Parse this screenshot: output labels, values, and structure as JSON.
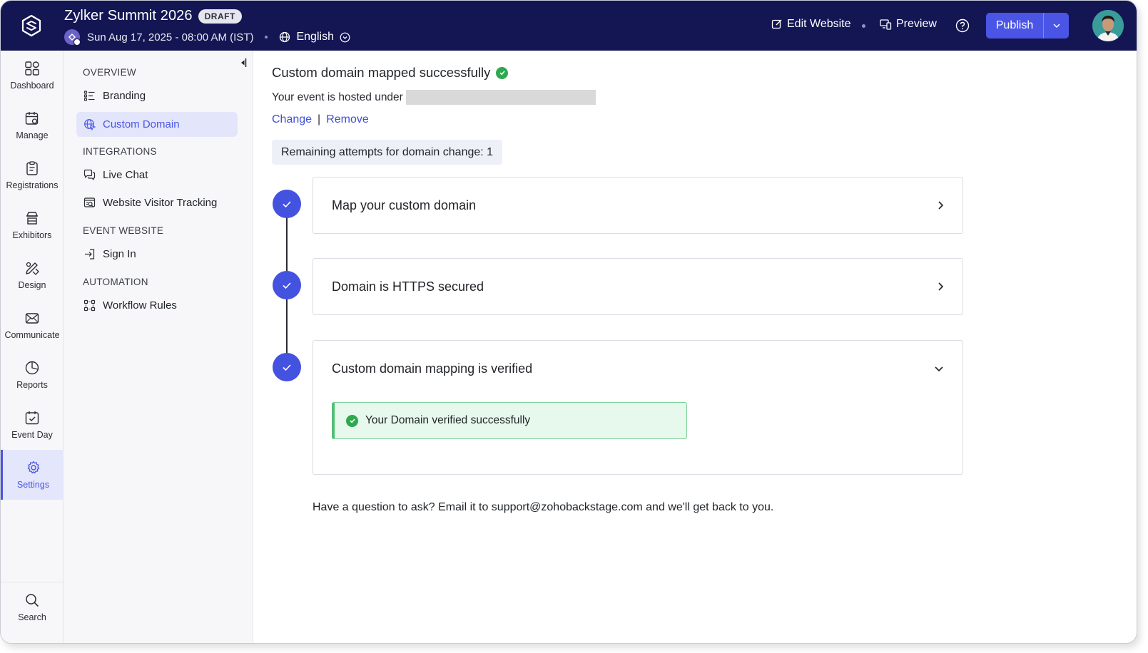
{
  "header": {
    "event_title": "Zylker Summit 2026",
    "draft_badge": "DRAFT",
    "date_time": "Sun Aug 17, 2025 - 08:00 AM (IST)",
    "language": "English",
    "edit_website": "Edit Website",
    "preview": "Preview",
    "publish": "Publish"
  },
  "rail": {
    "items": [
      {
        "label": "Dashboard",
        "icon": "grid-icon"
      },
      {
        "label": "Manage",
        "icon": "calendar-gear-icon"
      },
      {
        "label": "Registrations",
        "icon": "clipboard-icon"
      },
      {
        "label": "Exhibitors",
        "icon": "booth-icon"
      },
      {
        "label": "Design",
        "icon": "pen-ruler-icon"
      },
      {
        "label": "Communicate",
        "icon": "mail-icon"
      },
      {
        "label": "Reports",
        "icon": "pie-chart-icon"
      },
      {
        "label": "Event Day",
        "icon": "calendar-check-icon"
      },
      {
        "label": "Settings",
        "icon": "gear-icon"
      }
    ],
    "search": "Search"
  },
  "subnav": {
    "overview": "OVERVIEW",
    "branding": "Branding",
    "custom_domain": "Custom Domain",
    "integrations": "INTEGRATIONS",
    "live_chat": "Live Chat",
    "visitor_tracking": "Website Visitor Tracking",
    "event_website": "EVENT WEBSITE",
    "sign_in": "Sign In",
    "automation": "AUTOMATION",
    "workflow_rules": "Workflow Rules"
  },
  "main": {
    "success_title": "Custom domain mapped successfully",
    "hosted_under": "Your event is hosted under",
    "change": "Change",
    "pipe": "|",
    "remove": "Remove",
    "attempts": "Remaining attempts for domain change: 1",
    "steps": [
      {
        "title": "Map your custom domain"
      },
      {
        "title": "Domain is HTTPS secured"
      },
      {
        "title": "Custom domain mapping is verified"
      }
    ],
    "verified_message": "Your Domain verified successfully",
    "help_text": "Have a question to ask? Email it to support@zohobackstage.com and we'll get back to you."
  },
  "colors": {
    "header_bg": "#141654",
    "accent": "#4a55e6",
    "success": "#2fa84f"
  }
}
